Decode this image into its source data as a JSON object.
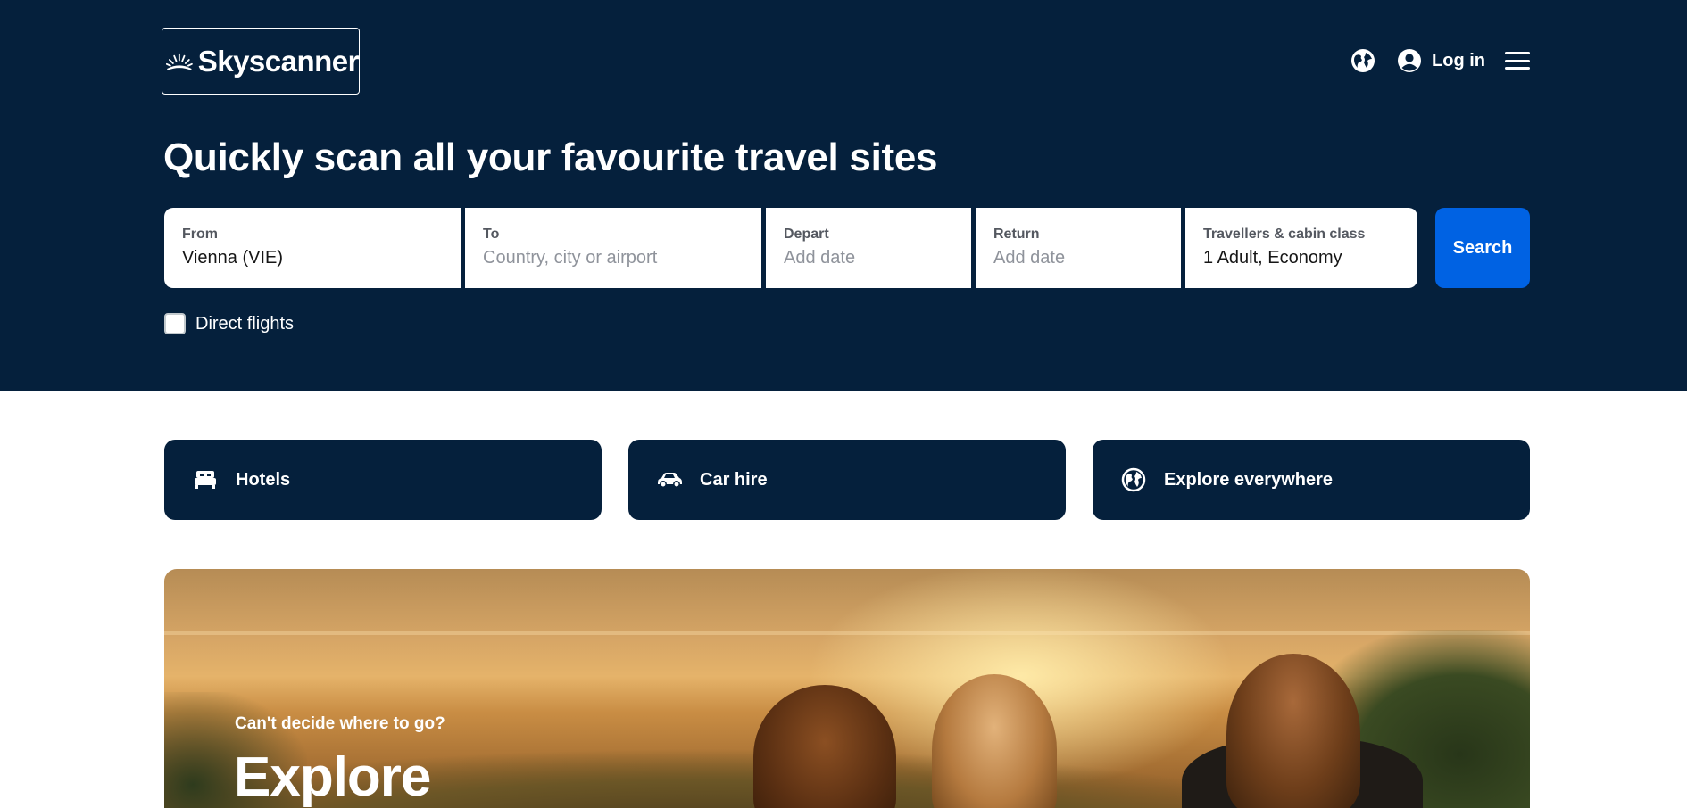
{
  "brand": {
    "name": "Skyscanner"
  },
  "topnav": {
    "login_label": "Log in"
  },
  "hero": {
    "headline": "Quickly scan all your favourite travel sites"
  },
  "search": {
    "from": {
      "label": "From",
      "value": "Vienna (VIE)"
    },
    "to": {
      "label": "To",
      "placeholder": "Country, city or airport"
    },
    "depart": {
      "label": "Depart",
      "placeholder": "Add date"
    },
    "return": {
      "label": "Return",
      "placeholder": "Add date"
    },
    "travellers": {
      "label": "Travellers & cabin class",
      "value": "1 Adult, Economy"
    },
    "button_label": "Search",
    "direct_flights_label": "Direct flights",
    "direct_flights_checked": false
  },
  "quick_links": [
    {
      "label": "Hotels",
      "icon": "bed-icon"
    },
    {
      "label": "Car hire",
      "icon": "car-icon"
    },
    {
      "label": "Explore everywhere",
      "icon": "globe-icon"
    }
  ],
  "banner": {
    "kicker": "Can't decide where to go?",
    "title": "Explore"
  },
  "colors": {
    "hero_bg": "#05203c",
    "search_button": "#0062e3",
    "card_bg": "#05203c"
  }
}
